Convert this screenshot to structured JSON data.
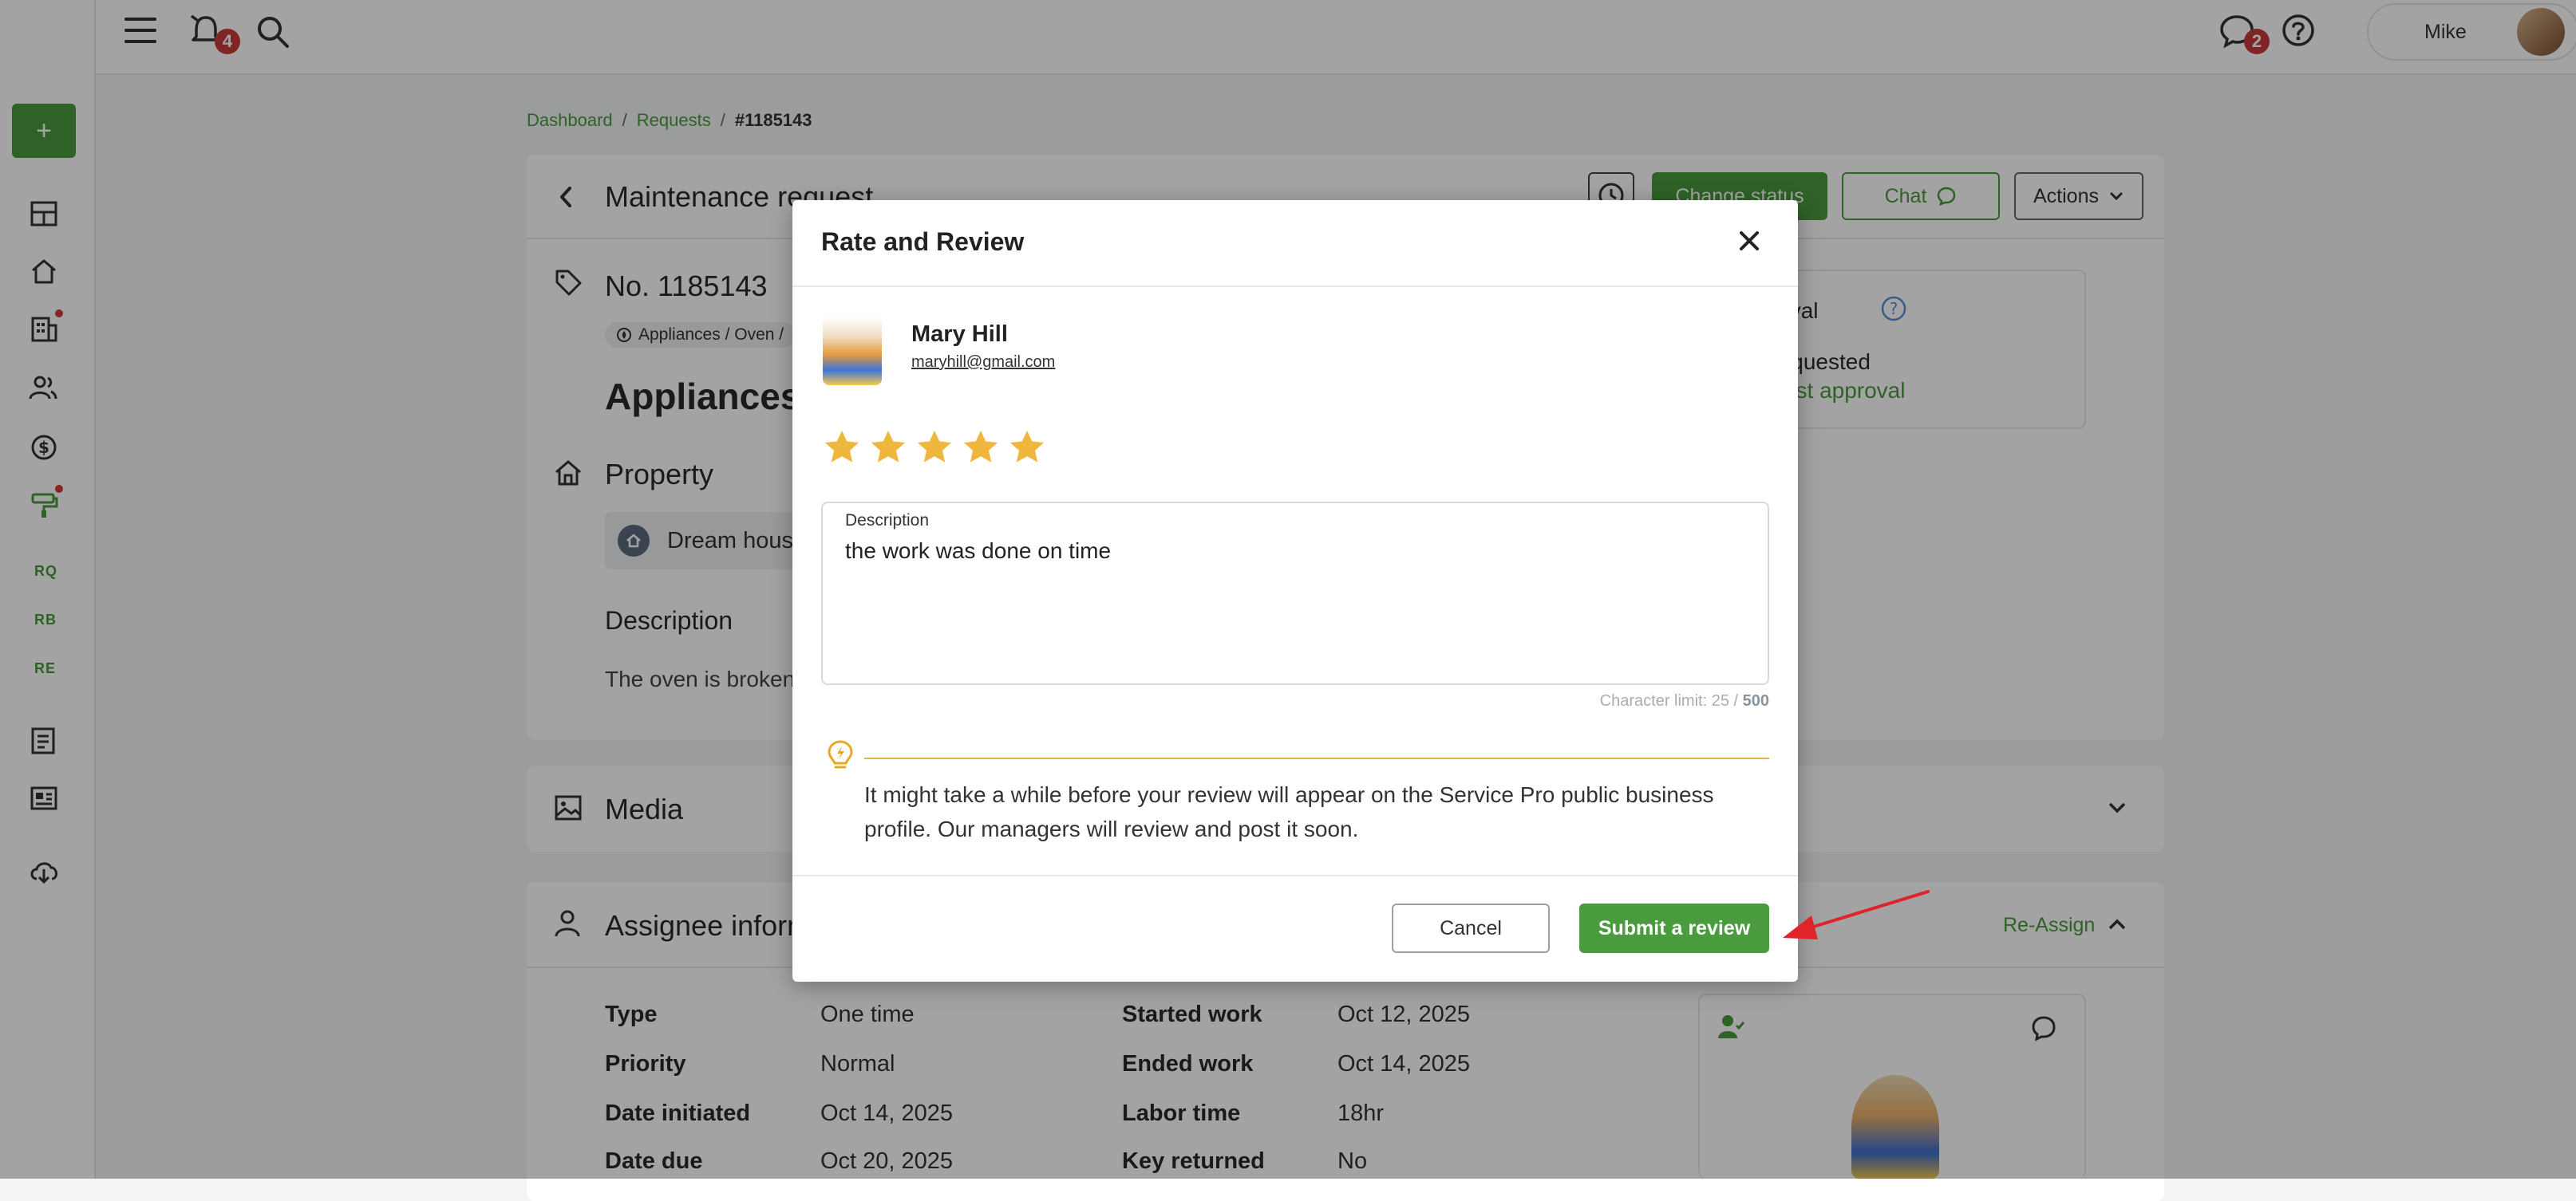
{
  "topbar": {
    "notifications_count": "4",
    "messages_count": "2",
    "user_name": "Mike"
  },
  "sidebar": {
    "add_label": "+",
    "items": [
      "RQ",
      "RB",
      "RE"
    ]
  },
  "breadcrumb": {
    "dashboard": "Dashboard",
    "requests": "Requests",
    "current": "#1185143",
    "sep": "/"
  },
  "request": {
    "title": "Maintenance request",
    "change_status": "Change status",
    "chat": "Chat",
    "actions": "Actions",
    "number": "No. 1185143",
    "category": "Appliances / Oven /",
    "heading": "Appliances",
    "property_heading": "Property",
    "property_name": "Dream house",
    "description_heading": "Description",
    "description_text": "The oven is broken",
    "approval_heading": "Approval",
    "approval_status": "Not requested",
    "approval_link": "Request approval"
  },
  "media": {
    "heading": "Media"
  },
  "assignee": {
    "heading": "Assignee information",
    "reassign": "Re-Assign",
    "rows": [
      {
        "label": "Type",
        "value": "One time",
        "label2": "Started work",
        "value2": "Oct 12, 2025"
      },
      {
        "label": "Priority",
        "value": "Normal",
        "label2": "Ended work",
        "value2": "Oct 14, 2025"
      },
      {
        "label": "Date initiated",
        "value": "Oct 14, 2025",
        "label2": "Labor time",
        "value2": "18hr"
      },
      {
        "label": "Date due",
        "value": "Oct 20, 2025",
        "label2": "Key returned",
        "value2": "No"
      }
    ]
  },
  "modal": {
    "title": "Rate and Review",
    "reviewer_name": "Mary Hill",
    "reviewer_email": "maryhill@gmail.com",
    "rating": 5,
    "rating_max": 5,
    "description_label": "Description",
    "description_value": "the work was done on time",
    "char_limit_label": "Character limit: 25 /",
    "char_limit_max": "500",
    "info_text": "It might take a while before your review will appear on the Service Pro public business profile. Our managers will review and post it soon.",
    "cancel": "Cancel",
    "submit": "Submit a review"
  },
  "colors": {
    "brand_green": "#4a9a3e",
    "star": "#f0b73f",
    "badge_red": "#c83a3a",
    "arrow_red": "#e0242b"
  }
}
